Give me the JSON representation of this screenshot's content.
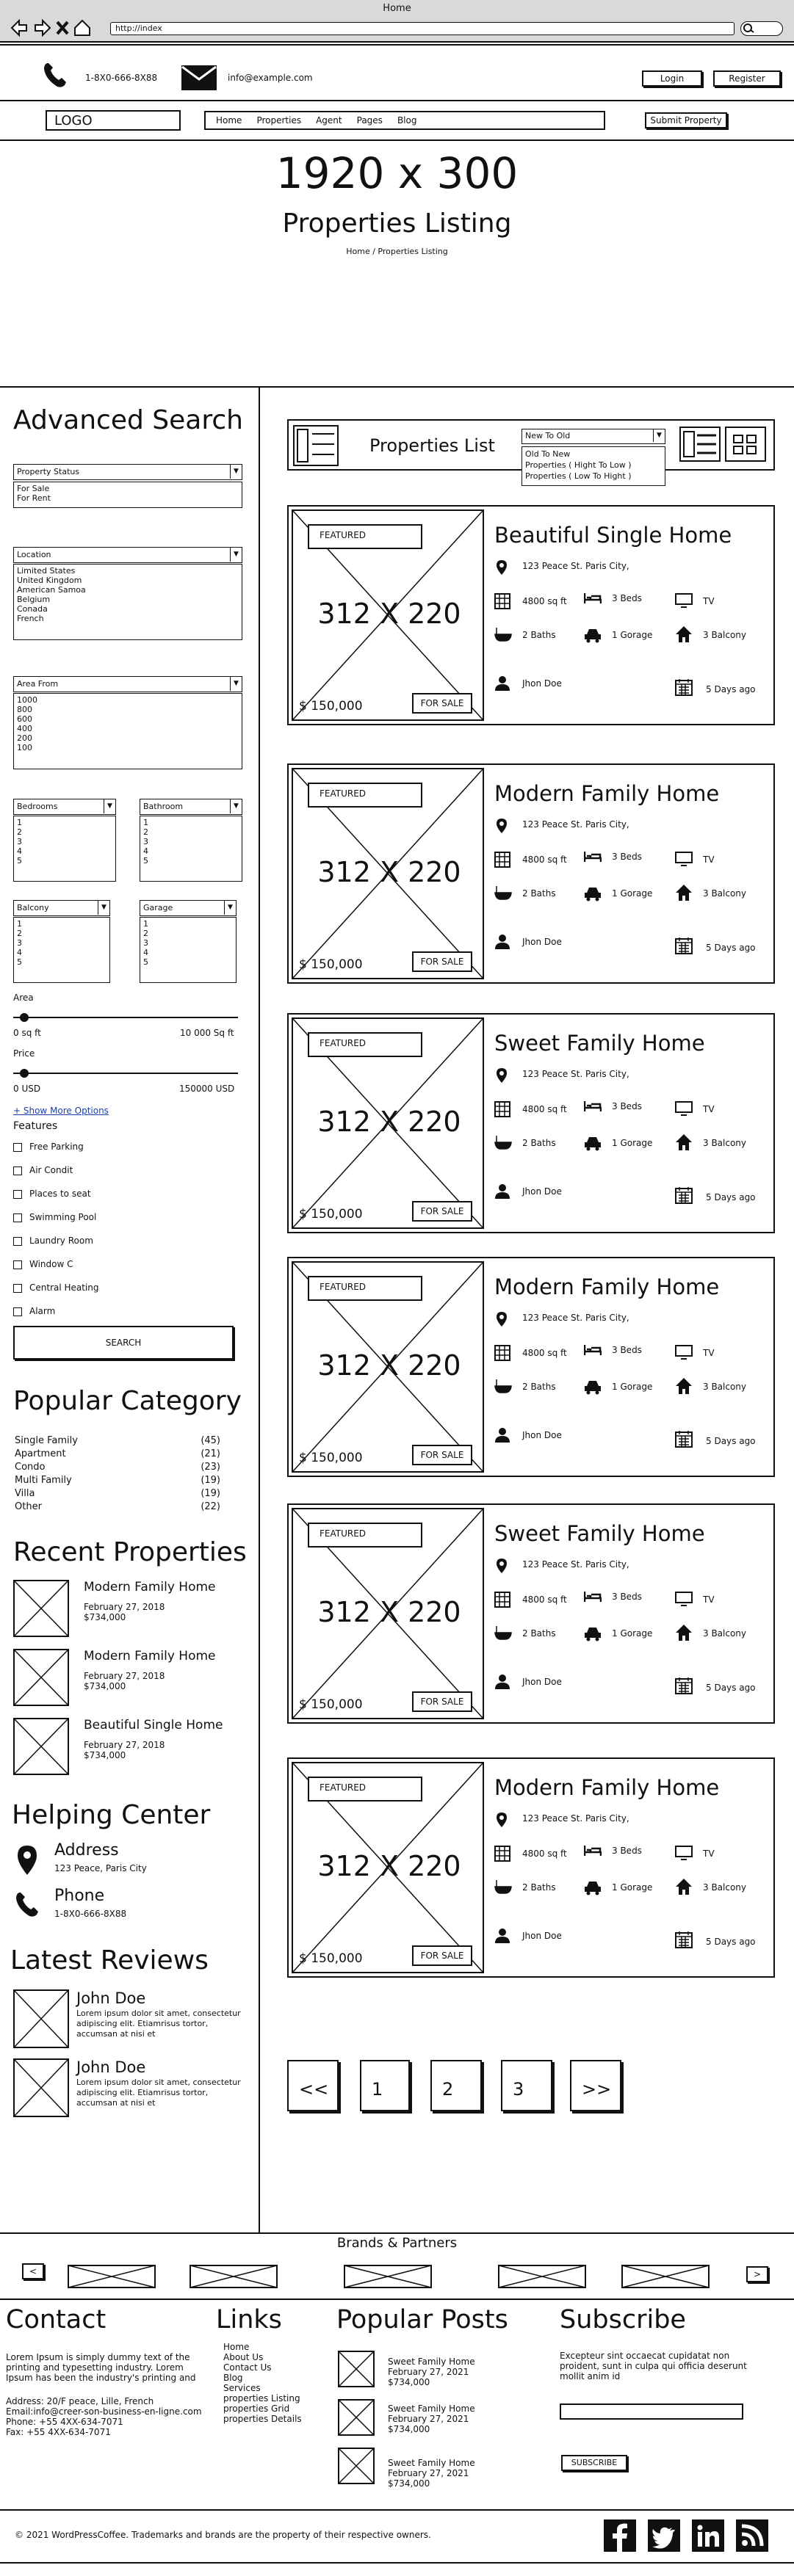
{
  "browser": {
    "title": "Home",
    "url": "http://index"
  },
  "topbar": {
    "phone": "1-8X0-666-8X88",
    "email": "info@example.com",
    "login": "Login",
    "register": "Register"
  },
  "nav": {
    "logo": "LOGO",
    "items": [
      "Home",
      "Properties",
      "Agent",
      "Pages",
      "Blog"
    ],
    "submit": "Submit Property"
  },
  "hero": {
    "size": "1920 x 300",
    "title": "Properties Listing",
    "breadcrumb": "Home / Properties Listing"
  },
  "search": {
    "title": "Advanced Search",
    "status": {
      "selected": "Property Status",
      "options": [
        "For Sale",
        "For Rent"
      ]
    },
    "location": {
      "selected": "Location",
      "options": [
        "Limited States",
        "United Kingdom",
        "American Samoa",
        "Belgium",
        "Conada",
        "French"
      ]
    },
    "area": {
      "selected": "Area From",
      "options": [
        "1000",
        "800",
        "600",
        "400",
        "200",
        "100"
      ]
    },
    "bedrooms": {
      "selected": "Bedrooms",
      "options": [
        "1",
        "2",
        "3",
        "4",
        "5"
      ]
    },
    "bathroom": {
      "selected": "Bathroom",
      "options": [
        "1",
        "2",
        "3",
        "4",
        "5"
      ]
    },
    "balcony": {
      "selected": "Balcony",
      "options": [
        "1",
        "2",
        "3",
        "4",
        "5"
      ]
    },
    "garage": {
      "selected": "Garage",
      "options": [
        "1",
        "2",
        "3",
        "4",
        "5"
      ]
    },
    "area_slider": {
      "label": "Area",
      "min": "0 sq ft",
      "max": "10 000 Sq ft",
      "value": 0.05
    },
    "price_slider": {
      "label": "Price",
      "min": "0 USD",
      "max": "150000 USD",
      "value": 0.05
    },
    "more": "+ Show More Options",
    "features_title": "Features",
    "features": [
      "Free Parking",
      "Air Condit",
      "Places to seat",
      "Swimming Pool",
      "Laundry Room",
      "Window C",
      "Central Heating",
      "Alarm"
    ],
    "button": "SEARCH"
  },
  "categories": {
    "title": "Popular Category",
    "items": [
      {
        "name": "Single Family",
        "count": "(45)"
      },
      {
        "name": "Apartment",
        "count": "(21)"
      },
      {
        "name": "Condo",
        "count": "(23)"
      },
      {
        "name": "Multi Family",
        "count": "(19)"
      },
      {
        "name": "Villa",
        "count": "(19)"
      },
      {
        "name": "Other",
        "count": "(22)"
      }
    ]
  },
  "recent": {
    "title": "Recent Properties",
    "items": [
      {
        "name": "Modern Family Home",
        "date": "February 27, 2018",
        "price": "$734,000"
      },
      {
        "name": "Modern Family Home",
        "date": "February 27, 2018",
        "price": "$734,000"
      },
      {
        "name": "Beautiful Single Home",
        "date": "February 27, 2018",
        "price": "$734,000"
      }
    ]
  },
  "help": {
    "title": "Helping Center",
    "address_label": "Address",
    "address": "123 Peace, Paris City",
    "phone_label": "Phone",
    "phone": "1-8X0-666-8X88"
  },
  "reviews": {
    "title": "Latest Reviews",
    "items": [
      {
        "name": "John Doe",
        "text": "Lorem ipsum dolor sit amet, consectetur adipiscing elit. Etiamrisus tortor, accumsan at nisi et"
      },
      {
        "name": "John Doe",
        "text": "Lorem ipsum dolor sit amet, consectetur adipiscing elit. Etiamrisus tortor, accumsan at nisi et"
      }
    ]
  },
  "listing": {
    "title": "Properties List",
    "sort": {
      "selected": "New To Old",
      "options": [
        "Old To New",
        "Properties ( Hight To Low )",
        "Properties (  Low To Hight )"
      ]
    }
  },
  "cards": [
    {
      "featured": "FEATURED",
      "img": "312 X 220",
      "price": "$ 150,000",
      "status": "FOR SALE",
      "title": "Beautiful Single Home",
      "address": "123 Peace St. Paris City,",
      "area": "4800 sq ft",
      "beds": "3 Beds",
      "tv": "TV",
      "baths": "2 Baths",
      "garage": "1 Gorage",
      "balcony": "3 Balcony",
      "agent": "Jhon Doe",
      "ago": "5 Days ago"
    },
    {
      "featured": "FEATURED",
      "img": "312 X 220",
      "price": "$ 150,000",
      "status": "FOR SALE",
      "title": "Modern Family Home",
      "address": "123 Peace St. Paris City,",
      "area": "4800 sq ft",
      "beds": "3 Beds",
      "tv": "TV",
      "baths": "2 Baths",
      "garage": "1 Gorage",
      "balcony": "3 Balcony",
      "agent": "Jhon Doe",
      "ago": "5 Days ago"
    },
    {
      "featured": "FEATURED",
      "img": "312 X 220",
      "price": "$ 150,000",
      "status": "FOR SALE",
      "title": "Sweet Family Home",
      "address": "123 Peace St. Paris City,",
      "area": "4800 sq ft",
      "beds": "3 Beds",
      "tv": "TV",
      "baths": "2 Baths",
      "garage": "1 Gorage",
      "balcony": "3 Balcony",
      "agent": "Jhon Doe",
      "ago": "5 Days ago"
    },
    {
      "featured": "FEATURED",
      "img": "312 X 220",
      "price": "$ 150,000",
      "status": "FOR SALE",
      "title": "Modern Family Home",
      "address": "123 Peace St. Paris City,",
      "area": "4800 sq ft",
      "beds": "3 Beds",
      "tv": "TV",
      "baths": "2 Baths",
      "garage": "1 Gorage",
      "balcony": "3 Balcony",
      "agent": "Jhon Doe",
      "ago": "5 Days ago"
    },
    {
      "featured": "FEATURED",
      "img": "312 X 220",
      "price": "$ 150,000",
      "status": "FOR SALE",
      "title": "Sweet Family Home",
      "address": "123 Peace St. Paris City,",
      "area": "4800 sq ft",
      "beds": "3 Beds",
      "tv": "TV",
      "baths": "2 Baths",
      "garage": "1 Gorage",
      "balcony": "3 Balcony",
      "agent": "Jhon Doe",
      "ago": "5 Days ago"
    },
    {
      "featured": "FEATURED",
      "img": "312 X 220",
      "price": "$ 150,000",
      "status": "FOR SALE",
      "title": "Modern Family Home",
      "address": "123 Peace St. Paris City,",
      "area": "4800 sq ft",
      "beds": "3 Beds",
      "tv": "TV",
      "baths": "2 Baths",
      "garage": "1 Gorage",
      "balcony": "3 Balcony",
      "agent": "Jhon Doe",
      "ago": "5 Days ago"
    }
  ],
  "pagination": [
    "<<",
    "1",
    "2",
    "3",
    ">>"
  ],
  "brands": {
    "title": "Brands & Partners",
    "prev": "<",
    "next": ">"
  },
  "footer": {
    "contact_title": "Contact",
    "contact_text": "Lorem Ipsum is simply dummy text of the printing and typesetting industry. Lorem Ipsum has been the industry's printing and",
    "address": "Address: 20/F peace, Lille, French",
    "email": "Email:info@creer-son-business-en-ligne.com",
    "phone": "Phone: +55 4XX-634-7071",
    "fax": "Fax: +55 4XX-634-7071",
    "links_title": "Links",
    "links": [
      "Home",
      "About Us",
      "Contact Us",
      "Blog",
      "Services",
      "properties Listing",
      "properties Grid",
      "properties Details"
    ],
    "posts_title": "Popular Posts",
    "posts": [
      {
        "name": "Sweet Family Home",
        "date": "February 27, 2021",
        "price": "$734,000"
      },
      {
        "name": "Sweet Family Home",
        "date": "February 27, 2021",
        "price": "$734,000"
      },
      {
        "name": "Sweet Family Home",
        "date": "February 27, 2021",
        "price": "$734,000"
      }
    ],
    "subscribe_title": "Subscribe",
    "subscribe_text": "Excepteur sint occaecat cupidatat non proident, sunt in culpa qui officia deserunt mollit anim id",
    "subscribe_button": "SUBSCRIBE",
    "copyright": "© 2021 WordPressCoffee. Trademarks and brands are the property of their respective owners."
  }
}
